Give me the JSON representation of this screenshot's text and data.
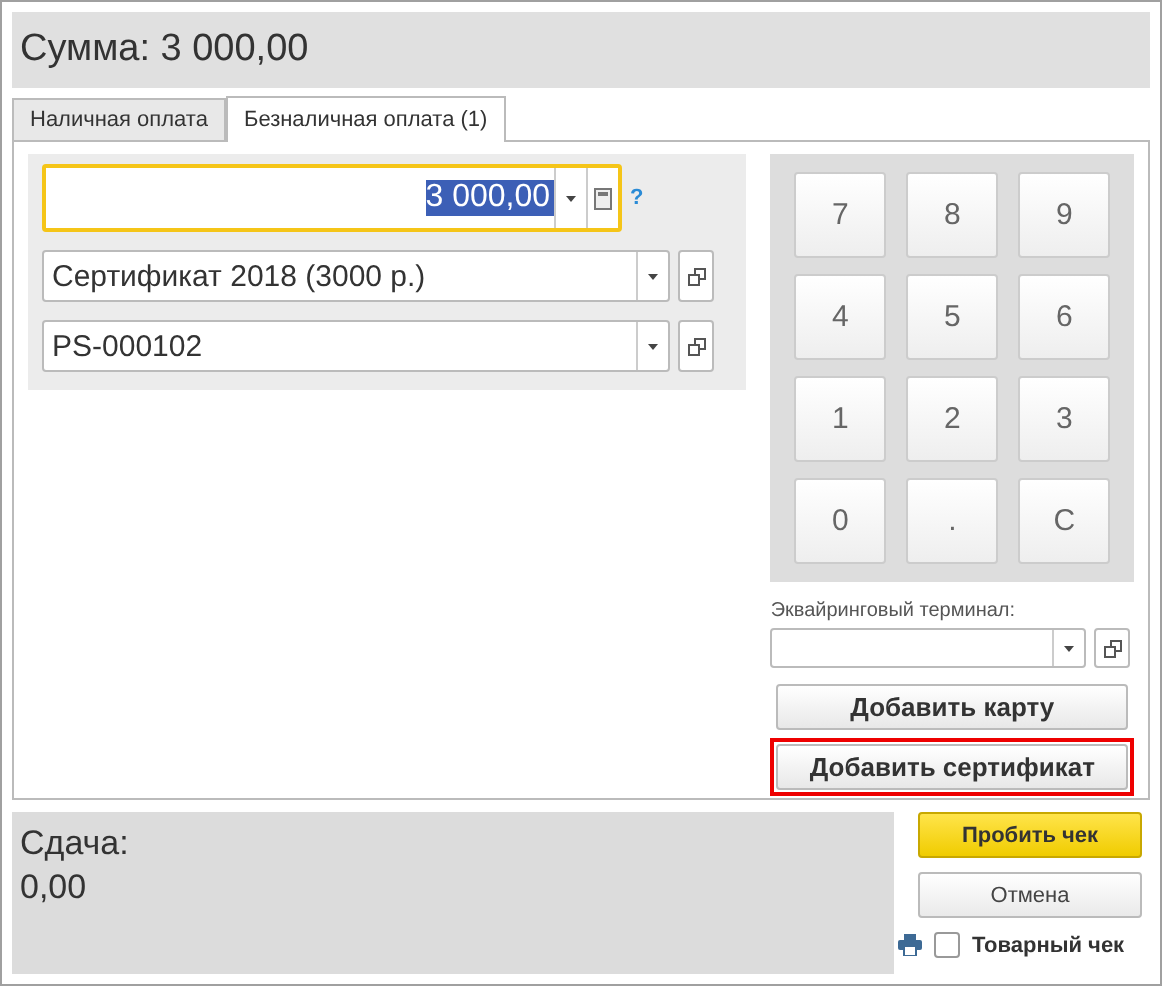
{
  "header": {
    "title": "Сумма: 3 000,00"
  },
  "tabs": [
    {
      "label": "Наличная оплата",
      "selected": false
    },
    {
      "label": "Безналичная оплата (1)",
      "selected": true
    }
  ],
  "amount_field": {
    "value": "3 000,00",
    "focused": true,
    "help": "?"
  },
  "certificate_field": {
    "value": "Сертификат 2018 (3000 р.)"
  },
  "number_field": {
    "value": "PS-000102"
  },
  "keypad": [
    "7",
    "8",
    "9",
    "4",
    "5",
    "6",
    "1",
    "2",
    "3",
    "0",
    ".",
    "C"
  ],
  "terminal": {
    "label": "Эквайринговый терминал:"
  },
  "side_buttons": [
    {
      "label": "Добавить карту",
      "highlighted": false
    },
    {
      "label": "Добавить сертификат",
      "highlighted": true
    }
  ],
  "change": {
    "label": "Сдача:",
    "value": "0,00"
  },
  "actions": [
    {
      "label": "Пробить чек",
      "kind": "primary"
    },
    {
      "label": "Отмена",
      "kind": "default"
    }
  ],
  "receipt_checkbox": {
    "label": "Товарный чек",
    "checked": false
  }
}
